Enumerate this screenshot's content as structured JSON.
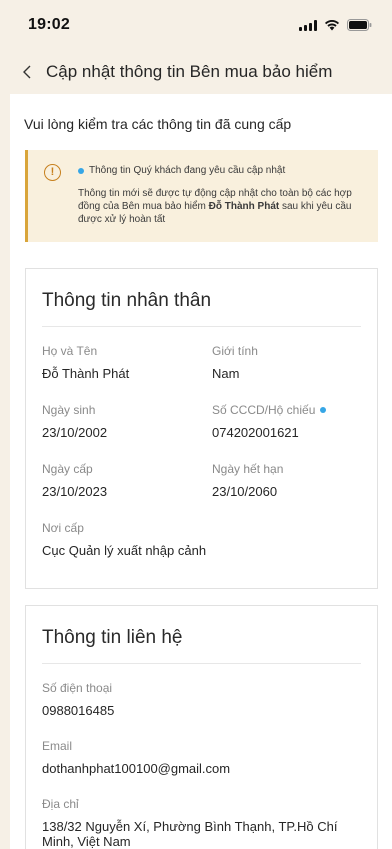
{
  "status_bar": {
    "time": "19:02"
  },
  "nav": {
    "title": "Cập nhật thông tin Bên mua bảo hiểm"
  },
  "intro": "Vui lòng kiểm tra các thông tin đã cung cấp",
  "notice": {
    "heading": "Thông tin Quý khách đang yêu cầu cập nhật",
    "text_before": "Thông tin mới sẽ được tự động cập nhật cho toàn bộ các hợp đồng của Bên mua bảo hiểm ",
    "name": "Đỗ Thành Phát",
    "text_after": " sau khi yêu cầu được xử lý hoàn tất"
  },
  "personal": {
    "title": "Thông tin nhân thân",
    "full_name_label": "Họ và Tên",
    "full_name": "Đỗ Thành Phát",
    "gender_label": "Giới tính",
    "gender": "Nam",
    "dob_label": "Ngày sinh",
    "dob": "23/10/2002",
    "id_label": "Số CCCD/Hộ chiếu",
    "id_value": "074202001621",
    "issue_date_label": "Ngày cấp",
    "issue_date": "23/10/2023",
    "expiry_label": "Ngày hết hạn",
    "expiry": "23/10/2060",
    "place_label": "Nơi cấp",
    "place": "Cục Quản lý xuất nhập cảnh"
  },
  "contact": {
    "title": "Thông tin liên hệ",
    "phone_label": "Số điện thoại",
    "phone": "0988016485",
    "email_label": "Email",
    "email": "dothanhphat100100@gmail.com",
    "address_label": "Địa chỉ",
    "address": "138/32 Nguyễn Xí, Phường Bình Thạnh, TP.Hồ Chí Minh, Việt Nam"
  },
  "colors": {
    "accent_dot": "#36a6e6",
    "warning": "#d9a53a",
    "header_bg": "#f6f0e6"
  }
}
